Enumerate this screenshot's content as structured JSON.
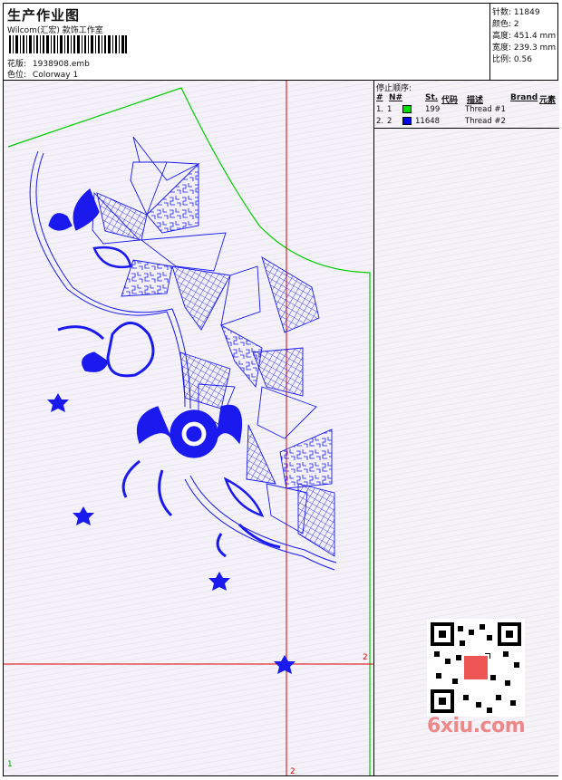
{
  "header": {
    "title": "生产作业图",
    "company": "Wilcom(汇宏) 款饰工作室",
    "design_label": "花版:",
    "design_file": "1938908.emb",
    "color_label": "色位:",
    "colorway": "Colorway 1"
  },
  "stats": {
    "stitches_label": "针数:",
    "stitches": "11849",
    "colors_label": "颜色:",
    "colors": "2",
    "height_label": "高度:",
    "height": "451.4 mm",
    "width_label": "宽度:",
    "width": "239.3 mm",
    "scale_label": "比例:",
    "scale": "0.56"
  },
  "panel": {
    "title": "停止顺序:",
    "columns": [
      "#",
      "N#",
      "St.",
      "代码",
      "描述",
      "Brand",
      "元素"
    ],
    "rows": [
      {
        "index": "1.",
        "n": "1",
        "color": "#00dd00",
        "code": "199",
        "desc": "Thread #1"
      },
      {
        "index": "2.",
        "n": "2",
        "color": "#0000ee",
        "code": "11648",
        "desc": "Thread #2"
      }
    ]
  },
  "markers": {
    "right": "2",
    "bottom": "2",
    "corner": "1"
  },
  "watermark": "6xiu.com",
  "colors": {
    "design_blue": "#1a1aee",
    "outline": "#1a1aee",
    "cut_green": "#00cc00",
    "guide_red": "#dd0000"
  }
}
